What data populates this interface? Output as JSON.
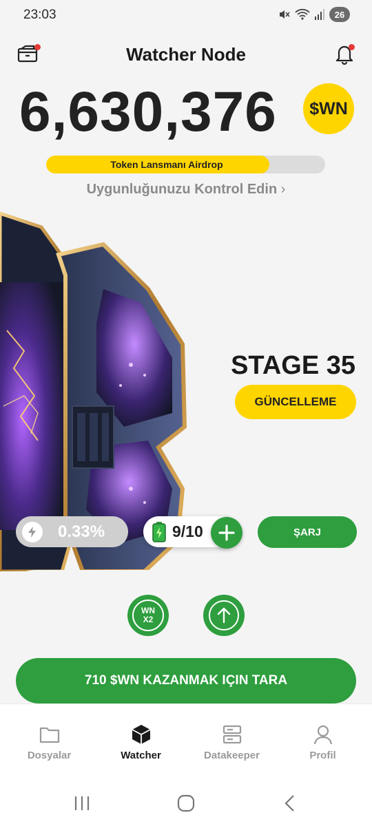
{
  "status_bar": {
    "time": "23:03",
    "battery": "26"
  },
  "header": {
    "title": "Watcher Node",
    "wallet_icon": "wallet-icon",
    "bell_icon": "bell-icon"
  },
  "balance": {
    "amount": "6,630,376",
    "token_badge": "$WN"
  },
  "airdrop": {
    "label": "Token Lansmanı Airdrop",
    "progress": 0.8,
    "check_link": "Uygunluğunuzu Kontrol Edin"
  },
  "stage": {
    "label": "STAGE 35",
    "upgrade_button": "GÜNCELLEME"
  },
  "stats": {
    "rate": "0.33%",
    "energy": "9/10",
    "charge_button": "ŞARJ"
  },
  "boosts": {
    "x2_line1": "WN",
    "x2_line2": "X2"
  },
  "scan_button": "710 $WN KAZANMAK IÇIN TARA",
  "bottom_nav": [
    {
      "label": "Dosyalar",
      "icon": "folder-icon",
      "active": false
    },
    {
      "label": "Watcher",
      "icon": "cube-icon",
      "active": true
    },
    {
      "label": "Datakeeper",
      "icon": "server-icon",
      "active": false
    },
    {
      "label": "Profil",
      "icon": "user-icon",
      "active": false
    }
  ],
  "colors": {
    "accent_yellow": "#ffd500",
    "accent_green": "#2e9e3e",
    "notification_red": "#e53935"
  }
}
